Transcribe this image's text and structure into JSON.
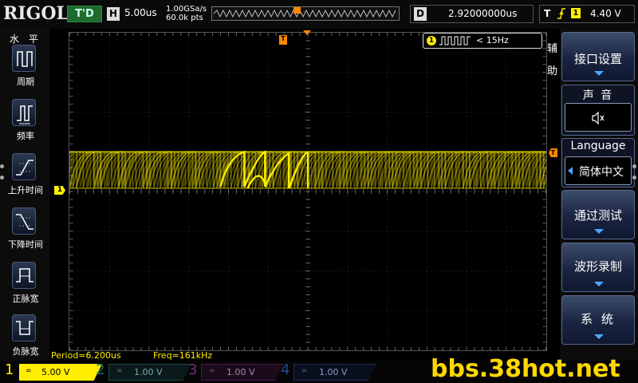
{
  "top_bar": {
    "brand": "RIGOL",
    "run_status": "T'D",
    "horizontal_label": "H",
    "horizontal_scale": "5.00us",
    "sample_rate": "1.00GSa/s",
    "memory_depth": "60.0k pts",
    "delay_label": "D",
    "delay_value": "2.92000000us",
    "trigger_label": "T",
    "trigger_source": "1",
    "trigger_level": "4.40 V",
    "trigger_mode_marker": "T"
  },
  "left_panel": {
    "title": "水 平",
    "items": [
      {
        "label": "周期",
        "icon": "period-icon"
      },
      {
        "label": "频率",
        "icon": "frequency-icon"
      },
      {
        "label": "上升时间",
        "icon": "rise-time-icon"
      },
      {
        "label": "下降时间",
        "icon": "fall-time-icon"
      },
      {
        "label": "正脉宽",
        "icon": "positive-width-icon"
      },
      {
        "label": "负脉宽",
        "icon": "negative-width-icon"
      }
    ]
  },
  "display": {
    "ch1_marker": "1",
    "trigger_marker": "T",
    "trigger_pos_marker": "T",
    "counter_channel": "1",
    "counter_text": "< 15Hz",
    "period": "Period=6.200us",
    "freq": "Freq=161kHz",
    "trace_color": "#ffee00"
  },
  "right_menu": {
    "title": "辅助",
    "title_chars": [
      "辅",
      "助"
    ],
    "interface_settings": "接口设置",
    "sound_title": "声 音",
    "sound_icon": "speaker-mute-icon",
    "language_title": "Language",
    "language_value": "简体中文",
    "pass_fail": "通过测试",
    "waveform_record": "波形录制",
    "system": "系 统"
  },
  "channels": [
    {
      "num": "1",
      "coupling": "=",
      "scale": "5.00 V",
      "color": "#ffee00",
      "active": true
    },
    {
      "num": "2",
      "coupling": "=",
      "scale": "1.00 V",
      "color": "#00c8c8",
      "active": false
    },
    {
      "num": "3",
      "coupling": "=",
      "scale": "1.00 V",
      "color": "#e040e0",
      "active": false
    },
    {
      "num": "4",
      "coupling": "=",
      "scale": "1.00 V",
      "color": "#3a7aff",
      "active": false
    }
  ],
  "watermark": "bbs.38hot.net",
  "colors": {
    "ch1": "#ffee00",
    "trigger": "#ff8800",
    "menu_arrow": "#4aa8ff"
  }
}
